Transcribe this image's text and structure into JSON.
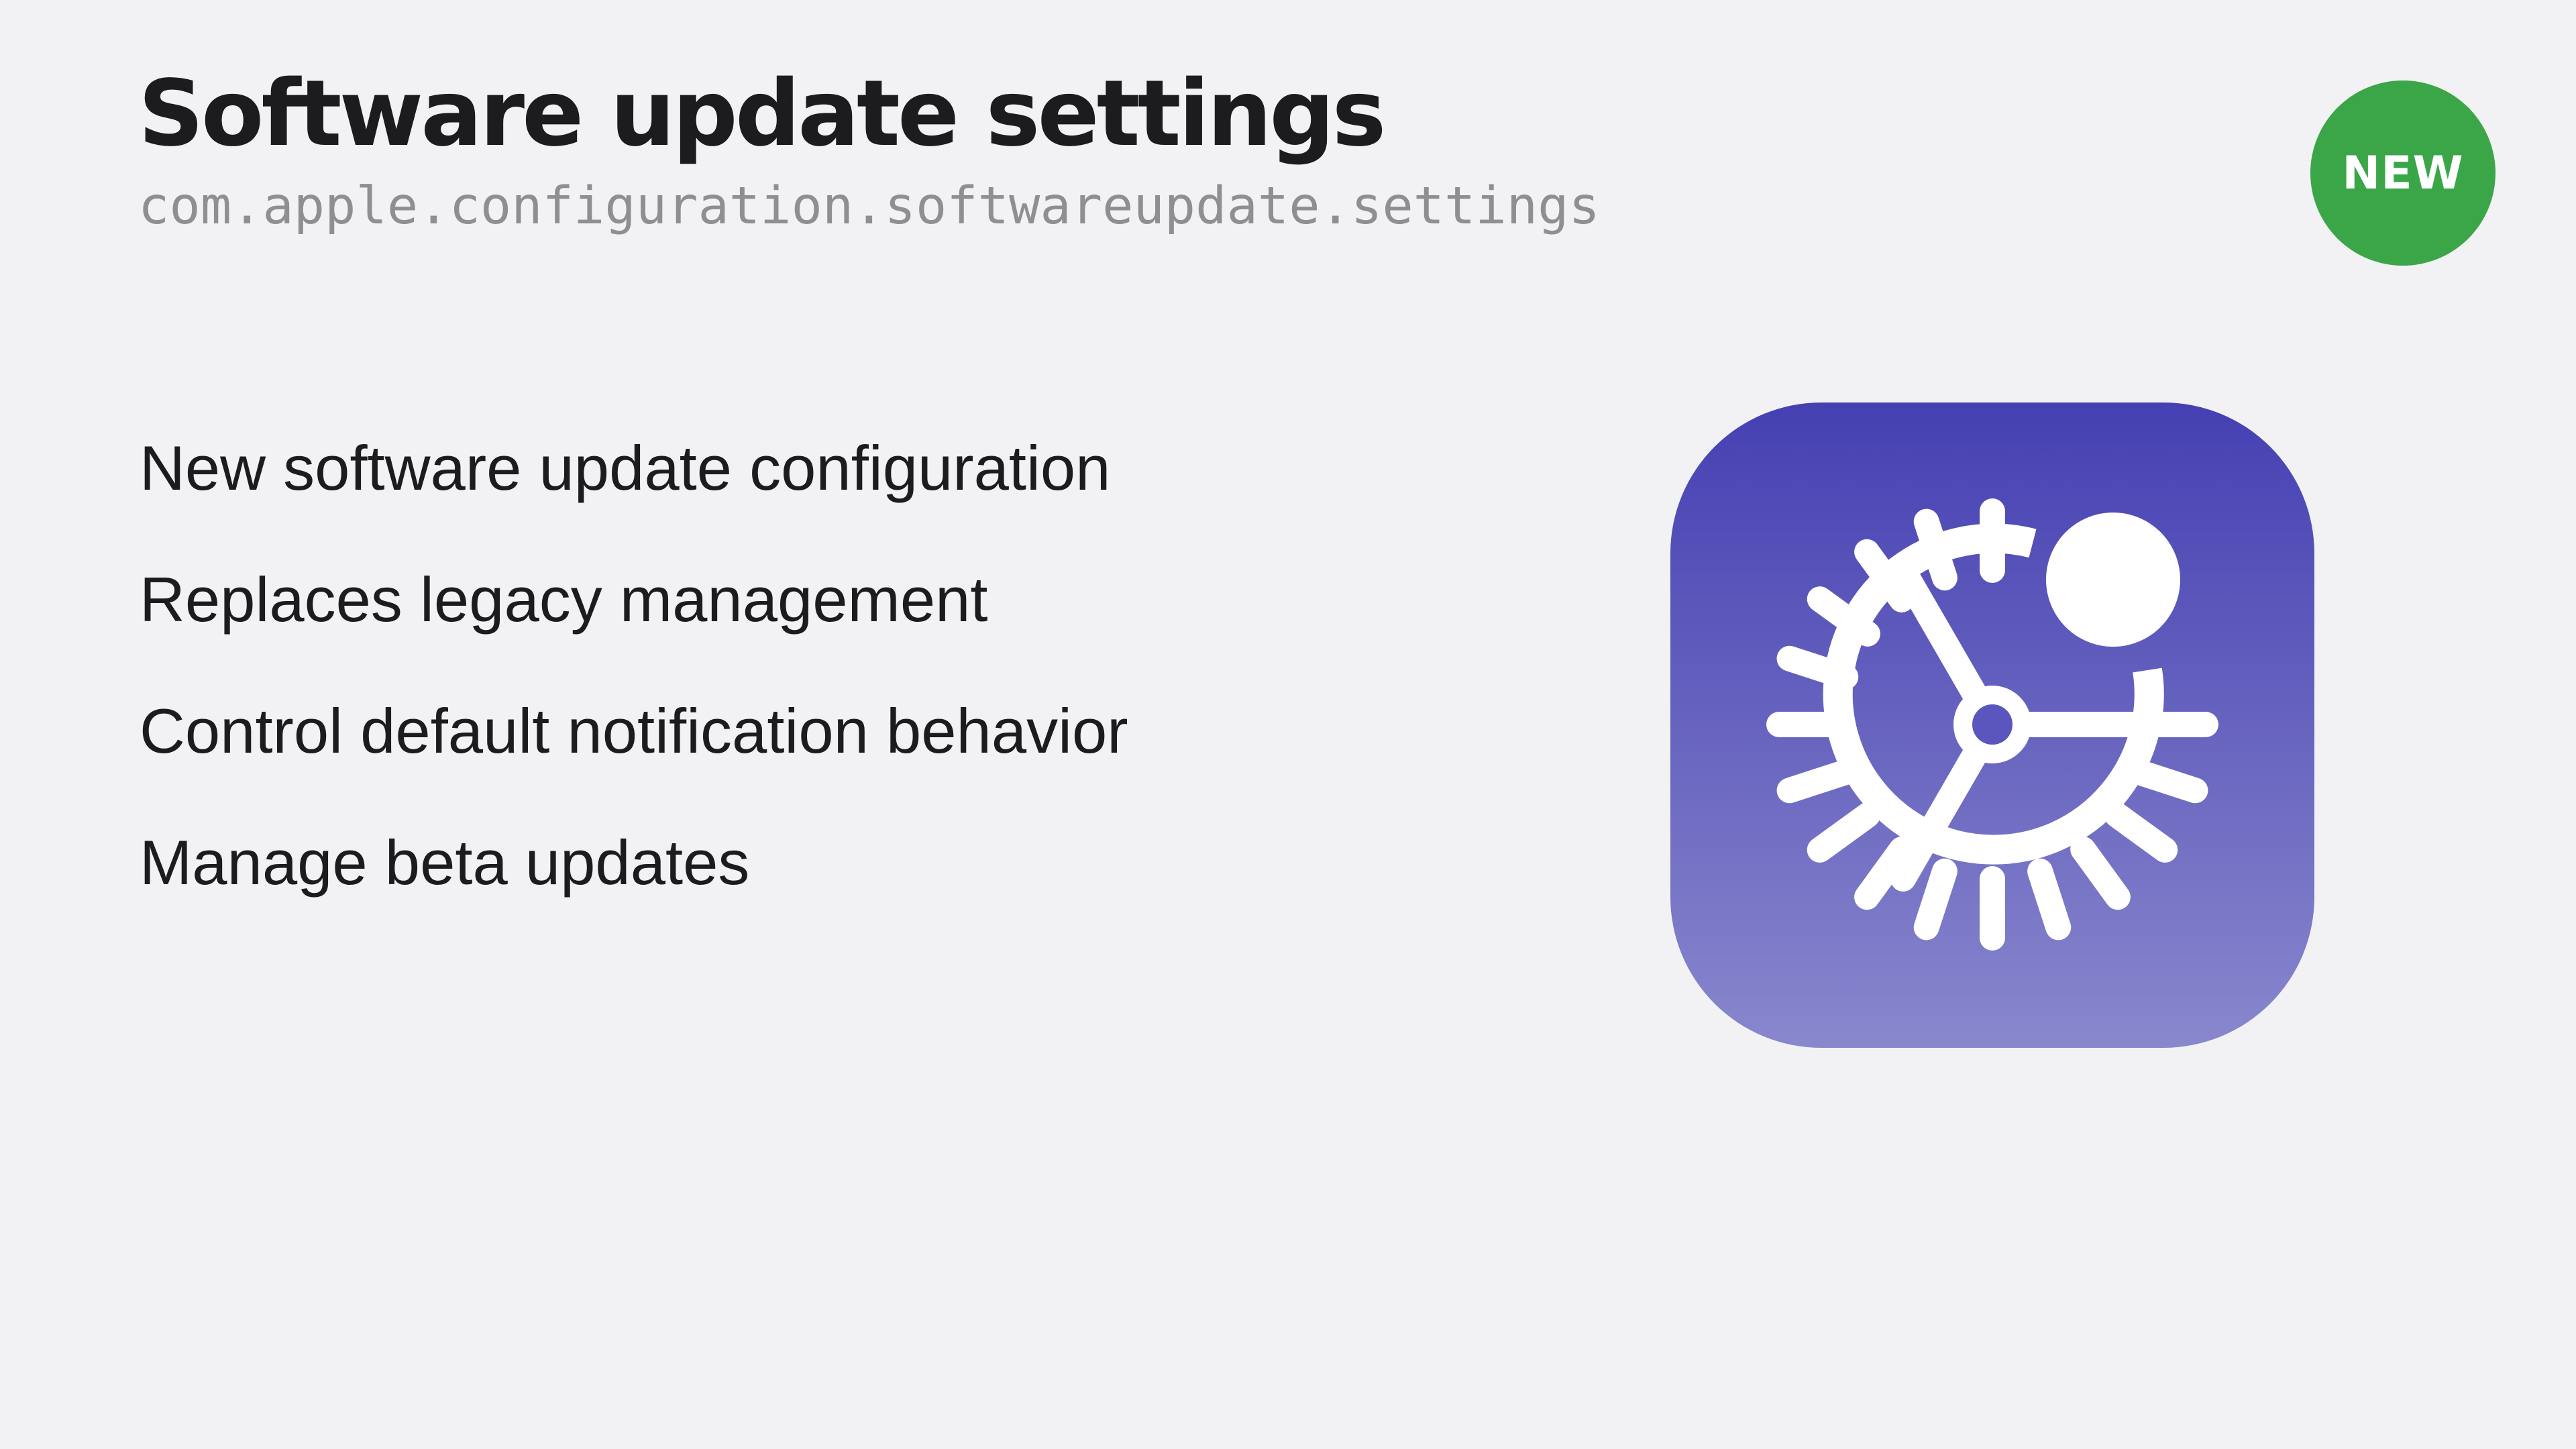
{
  "slide": {
    "title": "Software update settings",
    "identifier": "com.apple.configuration.softwareupdate.settings",
    "badge": "NEW",
    "bullets": [
      "New software update configuration",
      "Replaces legacy management",
      "Control default notification behavior",
      "Manage beta updates"
    ],
    "icon": "software-update-settings-gear-icon"
  },
  "colors": {
    "background": "#f2f2f4",
    "title": "#1c1c1e",
    "identifier": "#8e8e93",
    "badge": "#3aa647",
    "icon_gradient_top": "#4540b2",
    "icon_gradient_bottom": "#8987cd",
    "icon_glyph": "#ffffff"
  }
}
